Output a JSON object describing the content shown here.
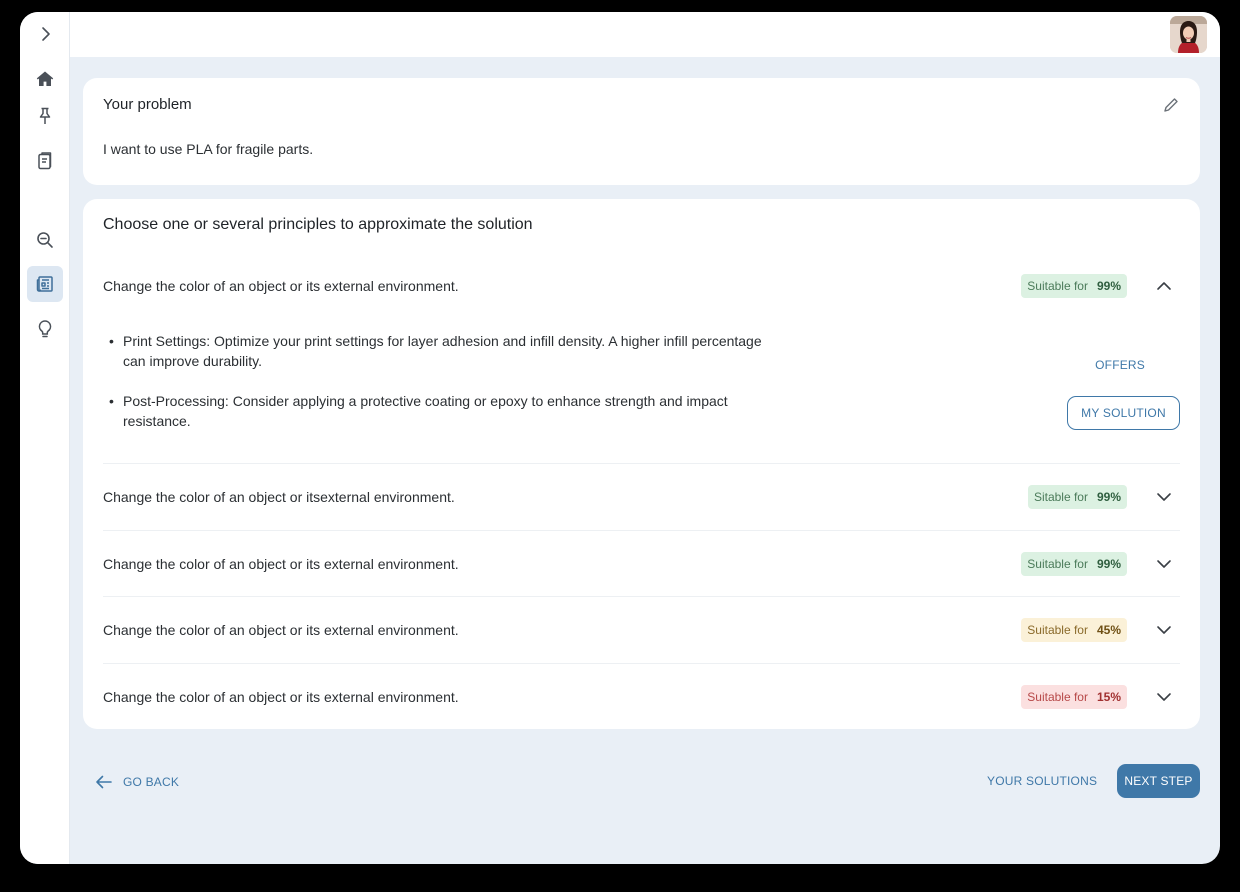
{
  "problem": {
    "title": "Your problem",
    "text": "I want to use PLA for fragile parts."
  },
  "principles": {
    "title": "Choose one or several principles to approximate the solution",
    "rows": [
      {
        "label": "Change the color of an object or its external environment.",
        "badge_text": "Suitable for",
        "percent": "99%",
        "status": "green",
        "expanded": true
      },
      {
        "label": "Change the color of an object or itsexternal environment.",
        "badge_text": "Sitable for",
        "percent": "99%",
        "status": "green",
        "expanded": false
      },
      {
        "label": "Change the color of an object or its external environment.",
        "badge_text": "Suitable for",
        "percent": "99%",
        "status": "green",
        "expanded": false
      },
      {
        "label": "Change the color of an object or its external environment.",
        "badge_text": "Suitable for",
        "percent": "45%",
        "status": "yellow",
        "expanded": false
      },
      {
        "label": "Change the color of an object or its external environment.",
        "badge_text": "Suitable for",
        "percent": "15%",
        "status": "red",
        "expanded": false
      }
    ],
    "details": [
      "Print Settings: Optimize your print settings for layer adhesion and infill density. A higher infill percentage can improve durability.",
      "Post-Processing: Consider applying a protective coating or epoxy to enhance strength and impact resistance."
    ],
    "offers_label": "OFFERS",
    "my_solution_label": "MY SOLUTION"
  },
  "footer": {
    "go_back": "GO BACK",
    "your_solutions": "YOUR SOLUTIONS",
    "next_step": "NEXT STEP"
  },
  "sidebar": {
    "items": [
      {
        "icon": "chevron-right-icon"
      },
      {
        "icon": "home-icon"
      },
      {
        "icon": "pin-icon"
      },
      {
        "icon": "notes-icon"
      },
      {
        "icon": "search-icon"
      },
      {
        "icon": "newspaper-icon",
        "active": true
      },
      {
        "icon": "lightbulb-icon"
      }
    ]
  },
  "colors": {
    "accent": "#3f78a8",
    "background": "#e9eff6",
    "badge_green": "#dcf1e2",
    "badge_yellow": "#fbf1d8",
    "badge_red": "#fbe0e0"
  }
}
